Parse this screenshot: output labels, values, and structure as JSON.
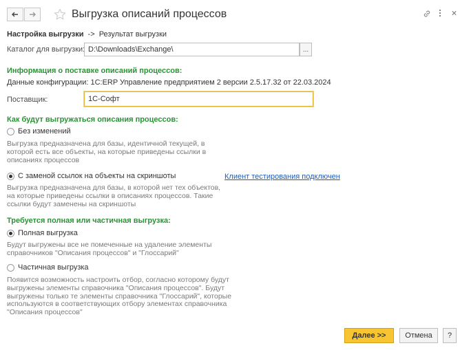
{
  "window": {
    "title": "Выгрузка описаний процессов",
    "breadcrumb": {
      "current": "Настройка выгрузки",
      "arrow": "->",
      "next": "Результат выгрузки"
    }
  },
  "export_dir": {
    "label": "Каталог для выгрузки:",
    "value": "D:\\Downloads\\Exchange\\",
    "select_label": "..."
  },
  "supply_info": {
    "heading": "Информация о поставке описаний процессов:",
    "config_label": "Данные конфигурации:",
    "config_value": "1C:ERP Управление предприятием 2 версии 2.5.17.32 от 22.03.2024",
    "vendor_label": "Поставщик:",
    "vendor_value": "1С-Софт"
  },
  "export_mode": {
    "heading": "Как будут выгружаться описания процессов:",
    "option1": {
      "label": "Без изменений",
      "selected": false,
      "description": [
        "Выгрузка предназначена для базы, идентичной текущей, в",
        "которой есть все объекты, на которые приведены ссылки в",
        "описаниях процессов"
      ]
    },
    "option2": {
      "label": "С заменой ссылок на объекты на скриншоты",
      "selected": true,
      "description": [
        "Выгрузка предназначена для базы, в которой нет тех объектов,",
        "на которые приведены ссылки в описаниях процессов. Такие",
        "ссылки будут заменены на скриншоты"
      ]
    },
    "test_client_link": "Клиент тестирования подключен"
  },
  "export_scope": {
    "heading": "Требуется полная или частичная выгрузка:",
    "option1": {
      "label": "Полная выгрузка",
      "selected": true,
      "description": [
        "Будут выгружены все не помеченные на удаление элементы",
        "справочников \"Описания процессов\" и \"Глоссарий\""
      ]
    },
    "option2": {
      "label": "Частичная выгрузка",
      "selected": false,
      "description": [
        "Появится возможность настроить отбор, согласно которому будут",
        "выгружены элементы справочника \"Описания процессов\". Будут",
        "выгружены только те элементы справочника \"Глоссарий\", которые",
        "используются в соответствующих отбору элементах справочника",
        "\"Описания процессов\""
      ]
    }
  },
  "footer": {
    "next_label": "Далее >>",
    "cancel_label": "Отмена",
    "help_label": "?"
  },
  "colors": {
    "section_heading": "#2b9236",
    "primary_button": "#f7c531",
    "link": "#1a5bb5",
    "focus_border": "#e0b630"
  }
}
